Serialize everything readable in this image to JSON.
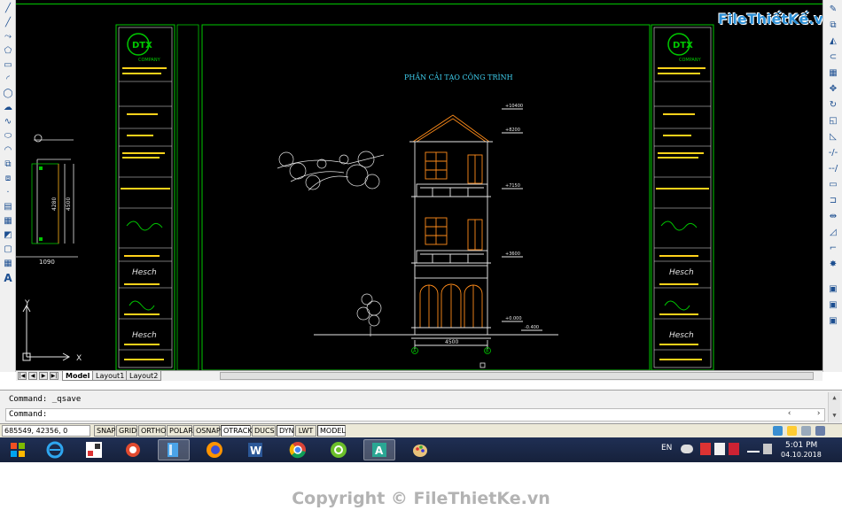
{
  "watermark": {
    "logo_text": "FileThiếtKế.vn",
    "copyright": "Copyright © FileThietKe.vn"
  },
  "drawing": {
    "title": "PHẦN CẢI TẠO CÔNG TRÌNH",
    "title_block": {
      "company_logo": "DTX",
      "company_sub": "COMPANY",
      "sign_label_1": "Hesch",
      "sign_label_2": "Hesch"
    },
    "dimensions": {
      "left_a": "4280",
      "left_b": "4500",
      "left_bottom": "1090",
      "elevation_width": "4500",
      "lvl_1": "+10400",
      "lvl_2": "+8200",
      "lvl_3": "+7150",
      "lvl_4": "+3600",
      "lvl_5": "+0.000",
      "lvl_6": "-0.400"
    },
    "axis_markers": [
      "A",
      "B"
    ],
    "ucs": {
      "x": "X",
      "y": "Y"
    }
  },
  "tabs": {
    "items": [
      "Model",
      "Layout1",
      "Layout2"
    ],
    "active": "Model"
  },
  "command": {
    "history": "Command:  _qsave",
    "prompt": "Command:",
    "input_value": ""
  },
  "status_bar": {
    "coords": "685549, 42356, 0",
    "toggles": [
      {
        "label": "SNAP",
        "on": false
      },
      {
        "label": "GRID",
        "on": false
      },
      {
        "label": "ORTHO",
        "on": false
      },
      {
        "label": "POLAR",
        "on": false
      },
      {
        "label": "OSNAP",
        "on": false
      },
      {
        "label": "OTRACK",
        "on": true
      },
      {
        "label": "DUCS",
        "on": false
      },
      {
        "label": "DYN",
        "on": true
      },
      {
        "label": "LWT",
        "on": false
      },
      {
        "label": "MODEL",
        "on": true
      }
    ]
  },
  "taskbar": {
    "language": "EN",
    "time": "5:01 PM",
    "date": "04.10.2018"
  },
  "colors": {
    "canvas": "#000000",
    "frame_green": "#00c800",
    "elevation_orange": "#ff8c1a",
    "title_cyan": "#3fd0f0",
    "white_lines": "#e6e6e6"
  }
}
